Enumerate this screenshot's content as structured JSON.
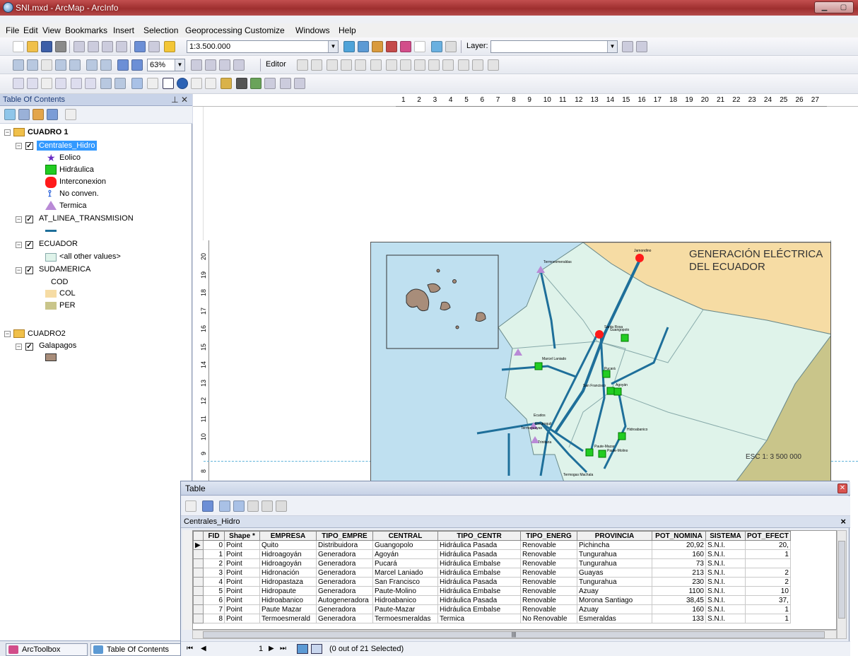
{
  "window": {
    "title": "SNI.mxd - ArcMap - ArcInfo"
  },
  "menu": [
    "File",
    "Edit",
    "View",
    "Bookmarks",
    "Insert",
    "Selection",
    "Geoprocessing",
    "Customize",
    "Windows",
    "Help"
  ],
  "toolbar": {
    "scale": "1:3.500.000",
    "zoom": "63%",
    "layer_label": "Layer:",
    "editor_label": "Editor"
  },
  "toc": {
    "title": "Table Of Contents",
    "groups": [
      {
        "name": "CUADRO 1",
        "layers": [
          {
            "name": "Centrales_Hidro",
            "checked": true,
            "legend": [
              "Eolico",
              "Hidráulica",
              "Interconexion",
              "No conven.",
              "Termica"
            ]
          },
          {
            "name": "AT_LINEA_TRANSMISION",
            "checked": true,
            "legend": []
          },
          {
            "name": "ECUADOR",
            "checked": true,
            "legend": [
              "<all other values>"
            ]
          },
          {
            "name": "SUDAMERICA",
            "checked": true,
            "field": "COD",
            "legend": [
              "COL",
              "PER"
            ]
          }
        ]
      },
      {
        "name": "CUADRO2",
        "layers": [
          {
            "name": "Galapagos",
            "checked": true,
            "legend": []
          }
        ]
      }
    ],
    "bottom_tabs": [
      "ArcToolbox",
      "Table Of Contents"
    ]
  },
  "ruler": {
    "h": [
      "1",
      "2",
      "3",
      "4",
      "5",
      "6",
      "7",
      "8",
      "9",
      "10",
      "11",
      "12",
      "13",
      "14",
      "15",
      "16",
      "17",
      "18",
      "19",
      "20",
      "21",
      "22",
      "23",
      "24",
      "25",
      "26",
      "27"
    ],
    "v": [
      "20",
      "19",
      "18",
      "17",
      "16",
      "15",
      "14",
      "13",
      "12",
      "11",
      "10",
      "9",
      "8"
    ]
  },
  "map": {
    "title_line1": "GENERACIÓN ELÉCTRICA",
    "title_line2": "DEL ECUADOR",
    "scale_text": "ESC 1: 3 500 000",
    "labels": [
      "Jamondino",
      "Termoesmeraldas",
      "Santa Rosa",
      "Guangopolo",
      "Marcel Laniado",
      "Pucará",
      "San Francisco",
      "Agoyán",
      "Ecudos",
      "Termoguayas",
      "Electroquil",
      "Trinitaria",
      "Hidroabanico",
      "Paute-Mazar",
      "Paute-Molino",
      "Termogas Machala"
    ],
    "colors": {
      "sea": "#bfe0f0",
      "ecuador": "#dff3ea",
      "colombia": "#f6dca4",
      "peru": "#c9c58a",
      "lines": "#1e6f9a",
      "hidro": "#22cc22",
      "termica": "#b98ad6",
      "interconexion": "#ff1a1a"
    }
  },
  "table": {
    "window_title": "Table",
    "layer_tab": "Centrales_Hidro",
    "columns": [
      "FID",
      "Shape *",
      "EMPRESA",
      "TIPO_EMPRE",
      "CENTRAL",
      "TIPO_CENTR",
      "TIPO_ENERG",
      "PROVINCIA",
      "POT_NOMINA",
      "SISTEMA",
      "POT_EFECT"
    ],
    "rows": [
      [
        "0",
        "Point",
        "Quito",
        "Distribuidora",
        "Guangopolo",
        "Hidráulica Pasada",
        "Renovable",
        "Pichincha",
        "20,92",
        "S.N.I.",
        "20,"
      ],
      [
        "1",
        "Point",
        "Hidroagoyán",
        "Generadora",
        "Agoyán",
        "Hidráulica Pasada",
        "Renovable",
        "Tungurahua",
        "160",
        "S.N.I.",
        "1"
      ],
      [
        "2",
        "Point",
        "Hidroagoyán",
        "Generadora",
        "Pucará",
        "Hidráulica Embalse",
        "Renovable",
        "Tungurahua",
        "73",
        "S.N.I.",
        ""
      ],
      [
        "3",
        "Point",
        "Hidronación",
        "Generadora",
        "Marcel Laniado",
        "Hidráulica Embalse",
        "Renovable",
        "Guayas",
        "213",
        "S.N.I.",
        "2"
      ],
      [
        "4",
        "Point",
        "Hidropastaza",
        "Generadora",
        "San Francisco",
        "Hidráulica Pasada",
        "Renovable",
        "Tungurahua",
        "230",
        "S.N.I.",
        "2"
      ],
      [
        "5",
        "Point",
        "Hidropaute",
        "Generadora",
        "Paute-Molino",
        "Hidráulica Embalse",
        "Renovable",
        "Azuay",
        "1100",
        "S.N.I.",
        "10"
      ],
      [
        "6",
        "Point",
        "Hidroabanico",
        "Autogeneradora",
        "Hidroabanico",
        "Hidráulica Pasada",
        "Renovable",
        "Morona Santiago",
        "38,45",
        "S.N.I.",
        "37,"
      ],
      [
        "7",
        "Point",
        "Paute Mazar",
        "Generadora",
        "Paute-Mazar",
        "Hidráulica Embalse",
        "Renovable",
        "Azuay",
        "160",
        "S.N.I.",
        "1"
      ],
      [
        "8",
        "Point",
        "Termoesmerald",
        "Generadora",
        "Termoesmeraldas",
        "Termica",
        "No Renovable",
        "Esmeraldas",
        "133",
        "S.N.I.",
        "1"
      ]
    ],
    "page_number": "1",
    "selection_status": "(0 out of 21 Selected)"
  }
}
